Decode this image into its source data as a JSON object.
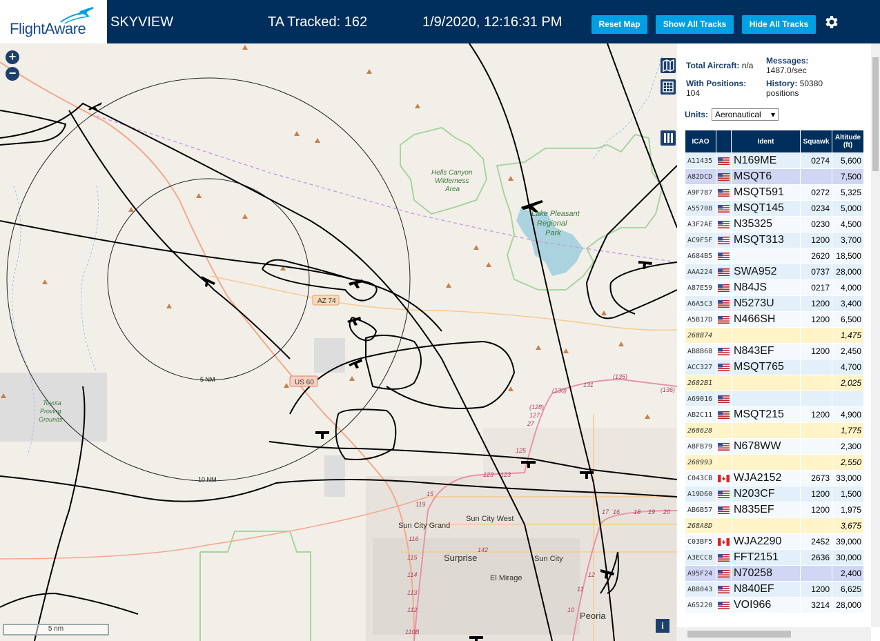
{
  "header": {
    "app_title": "SKYVIEW",
    "ta_tracked": "TA Tracked: 162",
    "datetime": "1/9/2020, 12:16:31 PM",
    "buttons": {
      "reset_map": "Reset Map",
      "show_all_tracks": "Show All Tracks",
      "hide_all_tracks": "Hide All Tracks"
    },
    "settings_icon": "gear-icon",
    "colors": {
      "bar": "#002f5d",
      "button": "#00a0e2"
    }
  },
  "logo": {
    "word_left": "Flight",
    "word_right": "Aware"
  },
  "map": {
    "zoom_in": "+",
    "zoom_out": "−",
    "scale_bar": "5 nm",
    "info": "i",
    "labels": {
      "hells_canyon_1": "Hells Canyon",
      "hells_canyon_2": "Wilderness",
      "hells_canyon_3": "Area",
      "lake_1": "Lake Pleasant",
      "lake_2": "Regional",
      "lake_3": "Park",
      "toyota_1": "Toyota",
      "toyota_2": "Proving",
      "toyota_3": "Grounds",
      "az74": "AZ 74",
      "us60": "US 60",
      "ring5": "5 NM",
      "ring10": "10 NM",
      "sun_city_grand": "Sun City Grand",
      "sun_city_west": "Sun City West",
      "surprise": "Surprise",
      "el_mirage": "El Mirage",
      "sun_city": "Sun City",
      "peoria": "Peoria",
      "r130": "(130)",
      "r131": "131",
      "r135": "(135)",
      "r136": "(136)",
      "r128": "(128)",
      "r127": "127",
      "r27": "27",
      "r125": "125",
      "r123a": "123",
      "r123b": "123",
      "r15": "15",
      "r119": "119",
      "r116": "116",
      "r115": "115",
      "r114": "114",
      "r113": "113",
      "r112": "112",
      "r110b": "110B",
      "r142": "142",
      "r17": "17",
      "r16": "16",
      "r18": "18",
      "r19": "19",
      "r20": "20",
      "r12": "12",
      "r11": "11",
      "r10": "10"
    }
  },
  "panel": {
    "total_aircraft_label": "Total Aircraft:",
    "total_aircraft_value": "n/a",
    "with_positions_label": "With Positions:",
    "with_positions_value": "104",
    "messages_label": "Messages:",
    "messages_value": "1487.0/sec",
    "history_label": "History:",
    "history_value": "50380",
    "history_unit": "positions",
    "units_label": "Units:",
    "units_value": "Aeronautical",
    "columns": {
      "icao": "ICAO",
      "flag": "",
      "ident": "Ident",
      "squawk": "Squawk",
      "altitude": "Altitude (ft)"
    },
    "rows": [
      {
        "icao": "A11435",
        "flag": "us",
        "ident": "N169ME",
        "squawk": "0274",
        "alt": "5,600",
        "style": "r0"
      },
      {
        "icao": "A82DCD",
        "flag": "us",
        "ident": "MSQT6",
        "squawk": "",
        "alt": "7,500",
        "style": "sel"
      },
      {
        "icao": "A9F787",
        "flag": "us",
        "ident": "MSQT591",
        "squawk": "0272",
        "alt": "5,325",
        "style": "r1"
      },
      {
        "icao": "A55708",
        "flag": "us",
        "ident": "MSQT145",
        "squawk": "0234",
        "alt": "5,000",
        "style": "r0"
      },
      {
        "icao": "A3F2AE",
        "flag": "us",
        "ident": "N35325",
        "squawk": "0230",
        "alt": "4,500",
        "style": "r1"
      },
      {
        "icao": "AC9F5F",
        "flag": "us",
        "ident": "MSQT313",
        "squawk": "1200",
        "alt": "3,700",
        "style": "r0"
      },
      {
        "icao": "A684B5",
        "flag": "us",
        "ident": "",
        "squawk": "2620",
        "alt": "18,500",
        "style": "r1"
      },
      {
        "icao": "AAA224",
        "flag": "us",
        "ident": "SWA952",
        "squawk": "0737",
        "alt": "28,000",
        "style": "r0"
      },
      {
        "icao": "A87E59",
        "flag": "us",
        "ident": "N84JS",
        "squawk": "0217",
        "alt": "4,000",
        "style": "r1"
      },
      {
        "icao": "A6A5C3",
        "flag": "us",
        "ident": "N5273U",
        "squawk": "1200",
        "alt": "3,400",
        "style": "r0"
      },
      {
        "icao": "A5B17D",
        "flag": "us",
        "ident": "N466SH",
        "squawk": "1200",
        "alt": "6,500",
        "style": "r1"
      },
      {
        "icao": "268B74",
        "flag": "",
        "ident": "",
        "squawk": "",
        "alt": "1,475",
        "style": "mlat"
      },
      {
        "icao": "AB8B68",
        "flag": "us",
        "ident": "N843EF",
        "squawk": "1200",
        "alt": "2,450",
        "style": "r1"
      },
      {
        "icao": "ACC327",
        "flag": "us",
        "ident": "MSQT765",
        "squawk": "",
        "alt": "4,700",
        "style": "r0"
      },
      {
        "icao": "2682B1",
        "flag": "",
        "ident": "",
        "squawk": "",
        "alt": "2,025",
        "style": "mlat"
      },
      {
        "icao": "A69016",
        "flag": "us",
        "ident": "",
        "squawk": "",
        "alt": "",
        "style": "r0"
      },
      {
        "icao": "AB2C11",
        "flag": "us",
        "ident": "MSQT215",
        "squawk": "1200",
        "alt": "4,900",
        "style": "r1"
      },
      {
        "icao": "268628",
        "flag": "",
        "ident": "",
        "squawk": "",
        "alt": "1,775",
        "style": "mlat"
      },
      {
        "icao": "A8FB79",
        "flag": "us",
        "ident": "N678WW",
        "squawk": "",
        "alt": "2,300",
        "style": "r1"
      },
      {
        "icao": "268993",
        "flag": "",
        "ident": "",
        "squawk": "",
        "alt": "2,550",
        "style": "mlat"
      },
      {
        "icao": "C043CB",
        "flag": "ca",
        "ident": "WJA2152",
        "squawk": "2673",
        "alt": "33,000",
        "style": "r1"
      },
      {
        "icao": "A19D60",
        "flag": "us",
        "ident": "N203CF",
        "squawk": "1200",
        "alt": "1,500",
        "style": "r0"
      },
      {
        "icao": "AB6B57",
        "flag": "us",
        "ident": "N835EF",
        "squawk": "1200",
        "alt": "1,975",
        "style": "r1"
      },
      {
        "icao": "268A8D",
        "flag": "",
        "ident": "",
        "squawk": "",
        "alt": "3,675",
        "style": "mlat"
      },
      {
        "icao": "C03BF5",
        "flag": "ca",
        "ident": "WJA2290",
        "squawk": "2452",
        "alt": "39,000",
        "style": "r1"
      },
      {
        "icao": "A3ECC8",
        "flag": "us",
        "ident": "FFT2151",
        "squawk": "2636",
        "alt": "30,000",
        "style": "r0"
      },
      {
        "icao": "A95F24",
        "flag": "us",
        "ident": "N70258",
        "squawk": "",
        "alt": "2,400",
        "style": "sel"
      },
      {
        "icao": "AB8043",
        "flag": "us",
        "ident": "N840EF",
        "squawk": "1200",
        "alt": "6,625",
        "style": "r0"
      },
      {
        "icao": "A65220",
        "flag": "us",
        "ident": "VOI966",
        "squawk": "3214",
        "alt": "28,000",
        "style": "r1"
      }
    ]
  }
}
